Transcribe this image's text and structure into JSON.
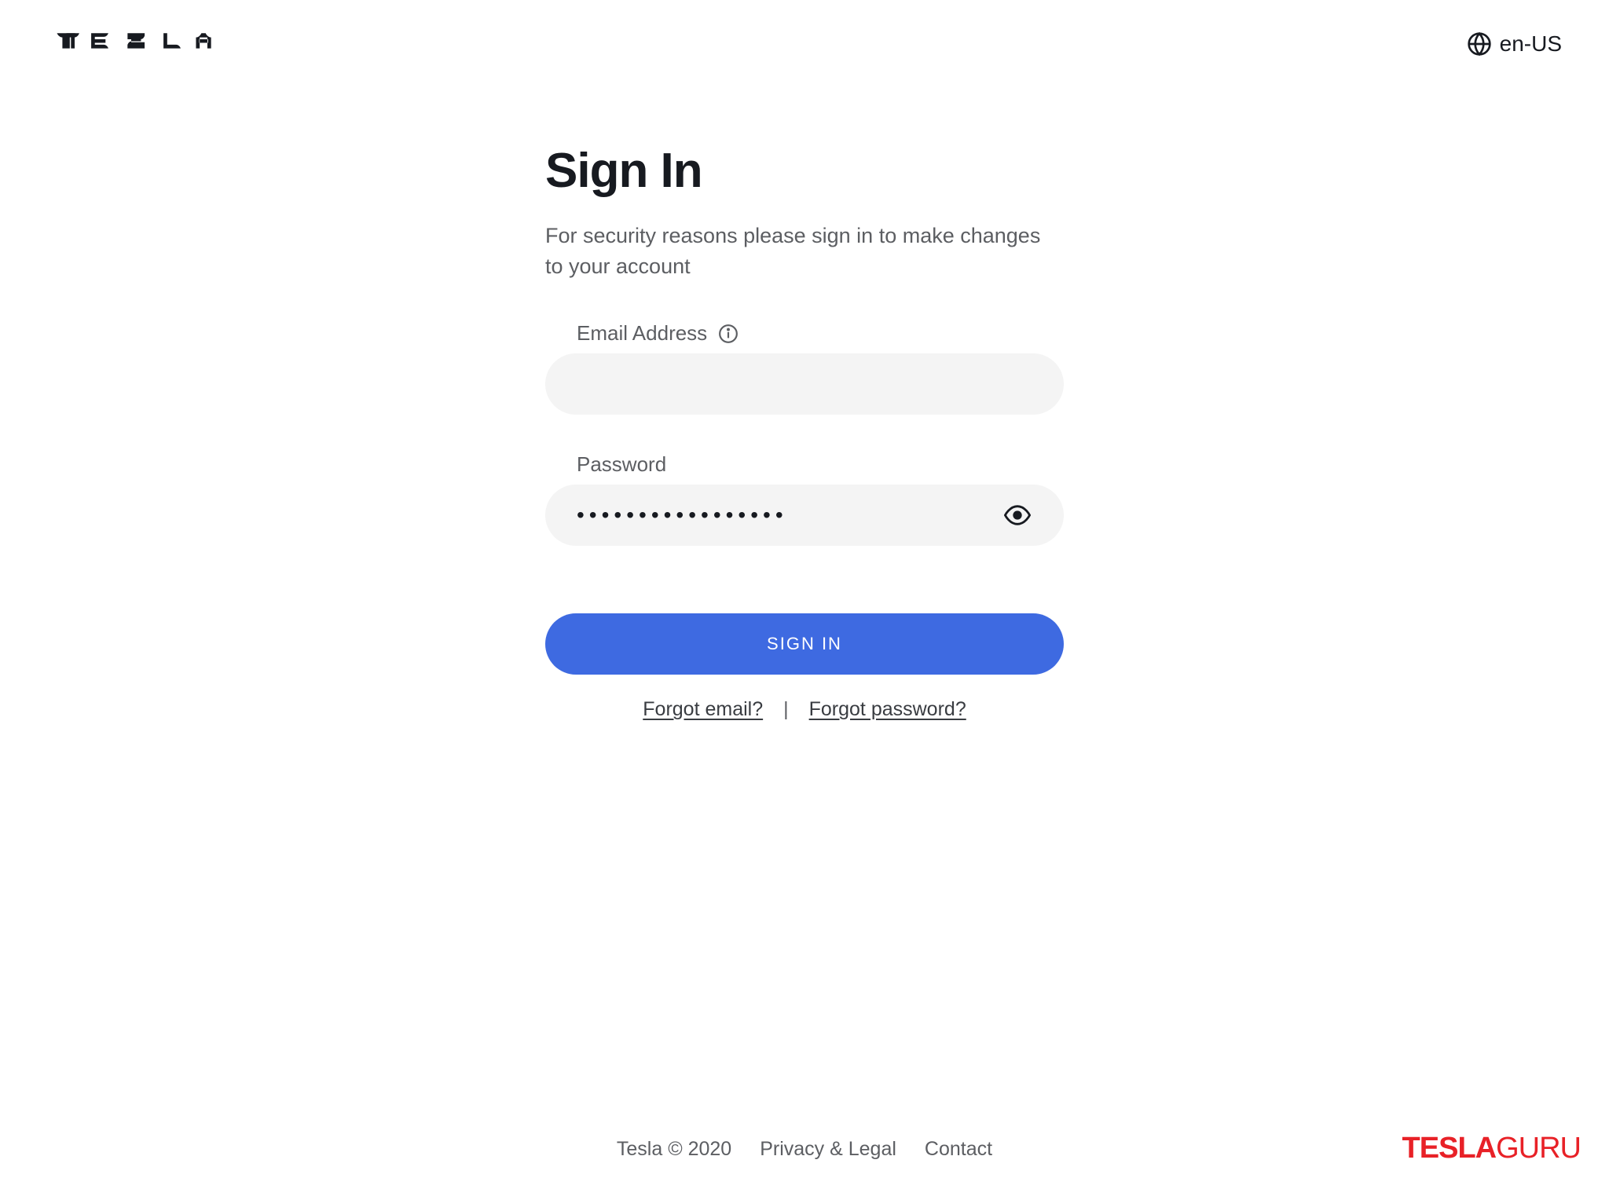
{
  "header": {
    "logo": "TESLA",
    "locale": "en-US"
  },
  "signin": {
    "title": "Sign In",
    "subtitle": "For security reasons please sign in to make changes to your account",
    "email_label": "Email Address",
    "email_value": "",
    "password_label": "Password",
    "password_value": "•••••••••••••••••",
    "submit_label": "SIGN IN",
    "forgot_email": "Forgot email?",
    "forgot_password": "Forgot password?",
    "link_divider": "|"
  },
  "footer": {
    "copyright": "Tesla © 2020",
    "privacy": "Privacy & Legal",
    "contact": "Contact"
  },
  "watermark": {
    "bold": "TESLA",
    "light": "GURU"
  }
}
